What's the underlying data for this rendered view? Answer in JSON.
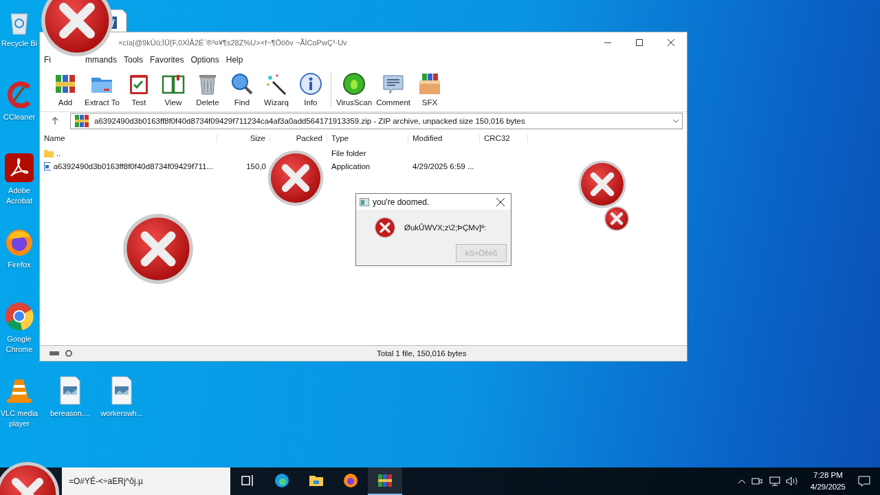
{
  "desktop_icons": [
    {
      "kind": "recycle",
      "label": "Recycle Bi"
    },
    {
      "kind": "word"
    },
    {
      "kind": "ccleaner",
      "label": "CCleaner"
    },
    {
      "kind": "acrobat",
      "label": "Adobe Acrobat"
    },
    {
      "kind": "firefox",
      "label": "Firefox"
    },
    {
      "kind": "chrome",
      "label": "Google Chrome"
    },
    {
      "kind": "vlc",
      "label": "VLC media player"
    },
    {
      "kind": "image",
      "label": "bereason...."
    },
    {
      "kind": "image",
      "label": "workerswh..."
    }
  ],
  "window": {
    "title": "×cía|@9kÙû;ÌÜ{F,0XÌÅ2É´®³¤¥¶s28Z%U>×f~¶Ööôv ~ÃÌCɒPwÇ³·Uv",
    "menu": [
      "Fi",
      "mmands",
      "Tools",
      "Favorites",
      "Options",
      "Help"
    ],
    "toolbar": [
      {
        "kind": "add",
        "label": "Add"
      },
      {
        "kind": "extract",
        "label": "Extract To"
      },
      {
        "kind": "test",
        "label": "Test"
      },
      {
        "kind": "view",
        "label": "View"
      },
      {
        "kind": "delete",
        "label": "Delete"
      },
      {
        "kind": "find",
        "label": "Find"
      },
      {
        "kind": "wizard",
        "label": "Wizarq"
      },
      {
        "kind": "info",
        "label": "Info"
      },
      {
        "kind": "virus",
        "label": "VirusScan"
      },
      {
        "kind": "comment",
        "label": "Comment"
      },
      {
        "kind": "sfx",
        "label": "SFX"
      }
    ],
    "address": "a6392490d3b0163ff8f0f40d8734f09429f711234ca4af3a0add564171913359.zip - ZIP archive, unpacked size 150,016 bytes",
    "columns": [
      "Name",
      "Size",
      "Packed",
      "Type",
      "Modified",
      "CRC32"
    ],
    "rows": [
      {
        "kind": "folder",
        "cells": [
          "..",
          "",
          "",
          "File folder",
          "",
          ""
        ]
      },
      {
        "kind": "app",
        "cells": [
          "a6392490d3b0163ff8f0f40d8734f09429f711...",
          "150,0",
          "",
          "Application",
          "4/29/2025 6:59 ...",
          ""
        ]
      }
    ],
    "status": "Total 1 file, 150,016 bytes"
  },
  "dialog": {
    "title": "you're doomed.",
    "message": "ØukÛWVX;z\\2;ÞÇMv]ª:",
    "button": {
      "label": "kS×Öêëõ",
      "disabled": true
    }
  },
  "taskbar": {
    "search_value": "=O#YÉ-<÷aERj^õj.µ",
    "apps": [
      {
        "kind": "taskview",
        "selected": false
      },
      {
        "kind": "edge",
        "selected": false
      },
      {
        "kind": "explorer",
        "selected": false
      },
      {
        "kind": "firefox",
        "selected": false
      },
      {
        "kind": "winrar",
        "selected": true
      }
    ],
    "time": "7:28 PM",
    "date": "4/29/2025"
  }
}
